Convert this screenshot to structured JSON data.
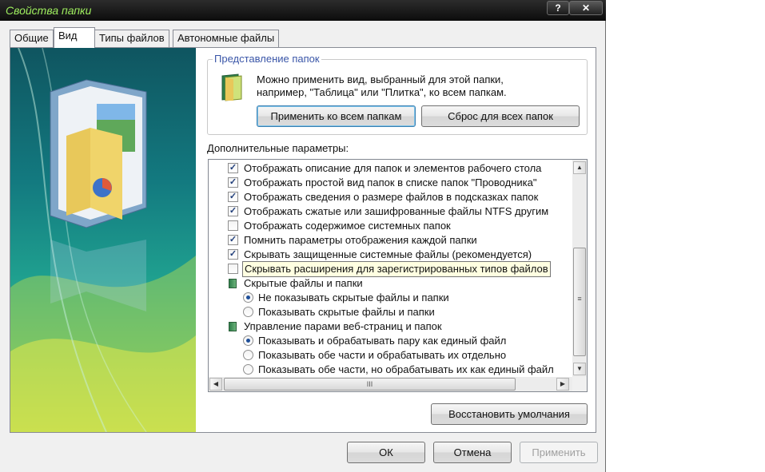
{
  "window": {
    "title": "Свойства папки"
  },
  "titlebar_buttons": {
    "help": "?",
    "close": "✕"
  },
  "tabs": [
    {
      "label": "Общие",
      "active": false
    },
    {
      "label": "Вид",
      "active": true
    },
    {
      "label": "Типы файлов",
      "active": false
    },
    {
      "label": "Автономные файлы",
      "active": false
    }
  ],
  "folder_views": {
    "legend": "Представление папок",
    "description_line1": "Можно применить вид, выбранный для этой папки,",
    "description_line2": "например, \"Таблица\" или \"Плитка\", ко всем папкам.",
    "apply_all_label": "Применить ко всем папкам",
    "reset_all_label": "Сброс для всех папок"
  },
  "advanced": {
    "label": "Дополнительные параметры:",
    "items": [
      {
        "kind": "checkbox",
        "checked": true,
        "text": "Отображать описание для папок и элементов рабочего стола"
      },
      {
        "kind": "checkbox",
        "checked": true,
        "text": "Отображать простой вид папок в списке папок \"Проводника\""
      },
      {
        "kind": "checkbox",
        "checked": true,
        "text": "Отображать сведения о размере файлов в подсказках папок"
      },
      {
        "kind": "checkbox",
        "checked": true,
        "text": "Отображать сжатые или зашифрованные файлы NTFS другим"
      },
      {
        "kind": "checkbox",
        "checked": false,
        "text": "Отображать содержимое системных папок"
      },
      {
        "kind": "checkbox",
        "checked": true,
        "text": "Помнить параметры отображения каждой папки"
      },
      {
        "kind": "checkbox",
        "checked": true,
        "text": "Скрывать защищенные системные файлы (рекомендуется)"
      },
      {
        "kind": "checkbox",
        "checked": false,
        "text": "Скрывать расширения для зарегистрированных типов файлов"
      },
      {
        "kind": "group",
        "text": "Скрытые файлы и папки"
      },
      {
        "kind": "radio",
        "checked": true,
        "text": "Не показывать скрытые файлы и папки"
      },
      {
        "kind": "radio",
        "checked": false,
        "text": "Показывать скрытые файлы и папки"
      },
      {
        "kind": "group",
        "text": "Управление парами веб-страниц и папок"
      },
      {
        "kind": "radio",
        "checked": true,
        "text": "Показывать и обрабатывать пару как единый файл"
      },
      {
        "kind": "radio",
        "checked": false,
        "text": "Показывать обе части и обрабатывать их отдельно"
      },
      {
        "kind": "radio",
        "checked": false,
        "text": "Показывать обе части, но обрабатывать их как единый файл"
      }
    ],
    "scroll_up": "▲",
    "scroll_down": "▼",
    "scroll_left": "◀",
    "scroll_right": "▶",
    "vthumb_grip": "≡",
    "hthumb_grip": "III"
  },
  "restore_defaults_label": "Восстановить умолчания",
  "footer": {
    "ok_label": "ОК",
    "cancel_label": "Отмена",
    "apply_label": "Применить"
  }
}
